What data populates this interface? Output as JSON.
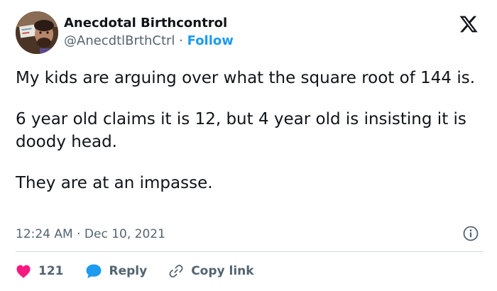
{
  "author": {
    "display_name": "Anecdotal Birthcontrol",
    "handle": "@AnecdtlBrthCtrl",
    "separator": "·",
    "follow_label": "Follow"
  },
  "tweet": {
    "paragraphs": [
      "My kids are arguing over what the square root of 144 is.",
      "6 year old claims it is 12, but 4 year old is insisting it is doody head.",
      "They are at an impasse."
    ],
    "time": "12:24 AM",
    "meta_separator": "·",
    "date": "Dec 10, 2021"
  },
  "actions": {
    "like_count": "121",
    "reply_label": "Reply",
    "copy_link_label": "Copy link"
  },
  "icons": {
    "brand": "x-logo-icon",
    "info": "info-icon",
    "like": "heart-icon",
    "reply": "reply-bubble-icon",
    "copy": "link-icon"
  },
  "colors": {
    "text": "#0f1419",
    "secondary": "#536471",
    "accent": "#1d9bf0",
    "like": "#f91880",
    "divider": "#cfd9de"
  }
}
